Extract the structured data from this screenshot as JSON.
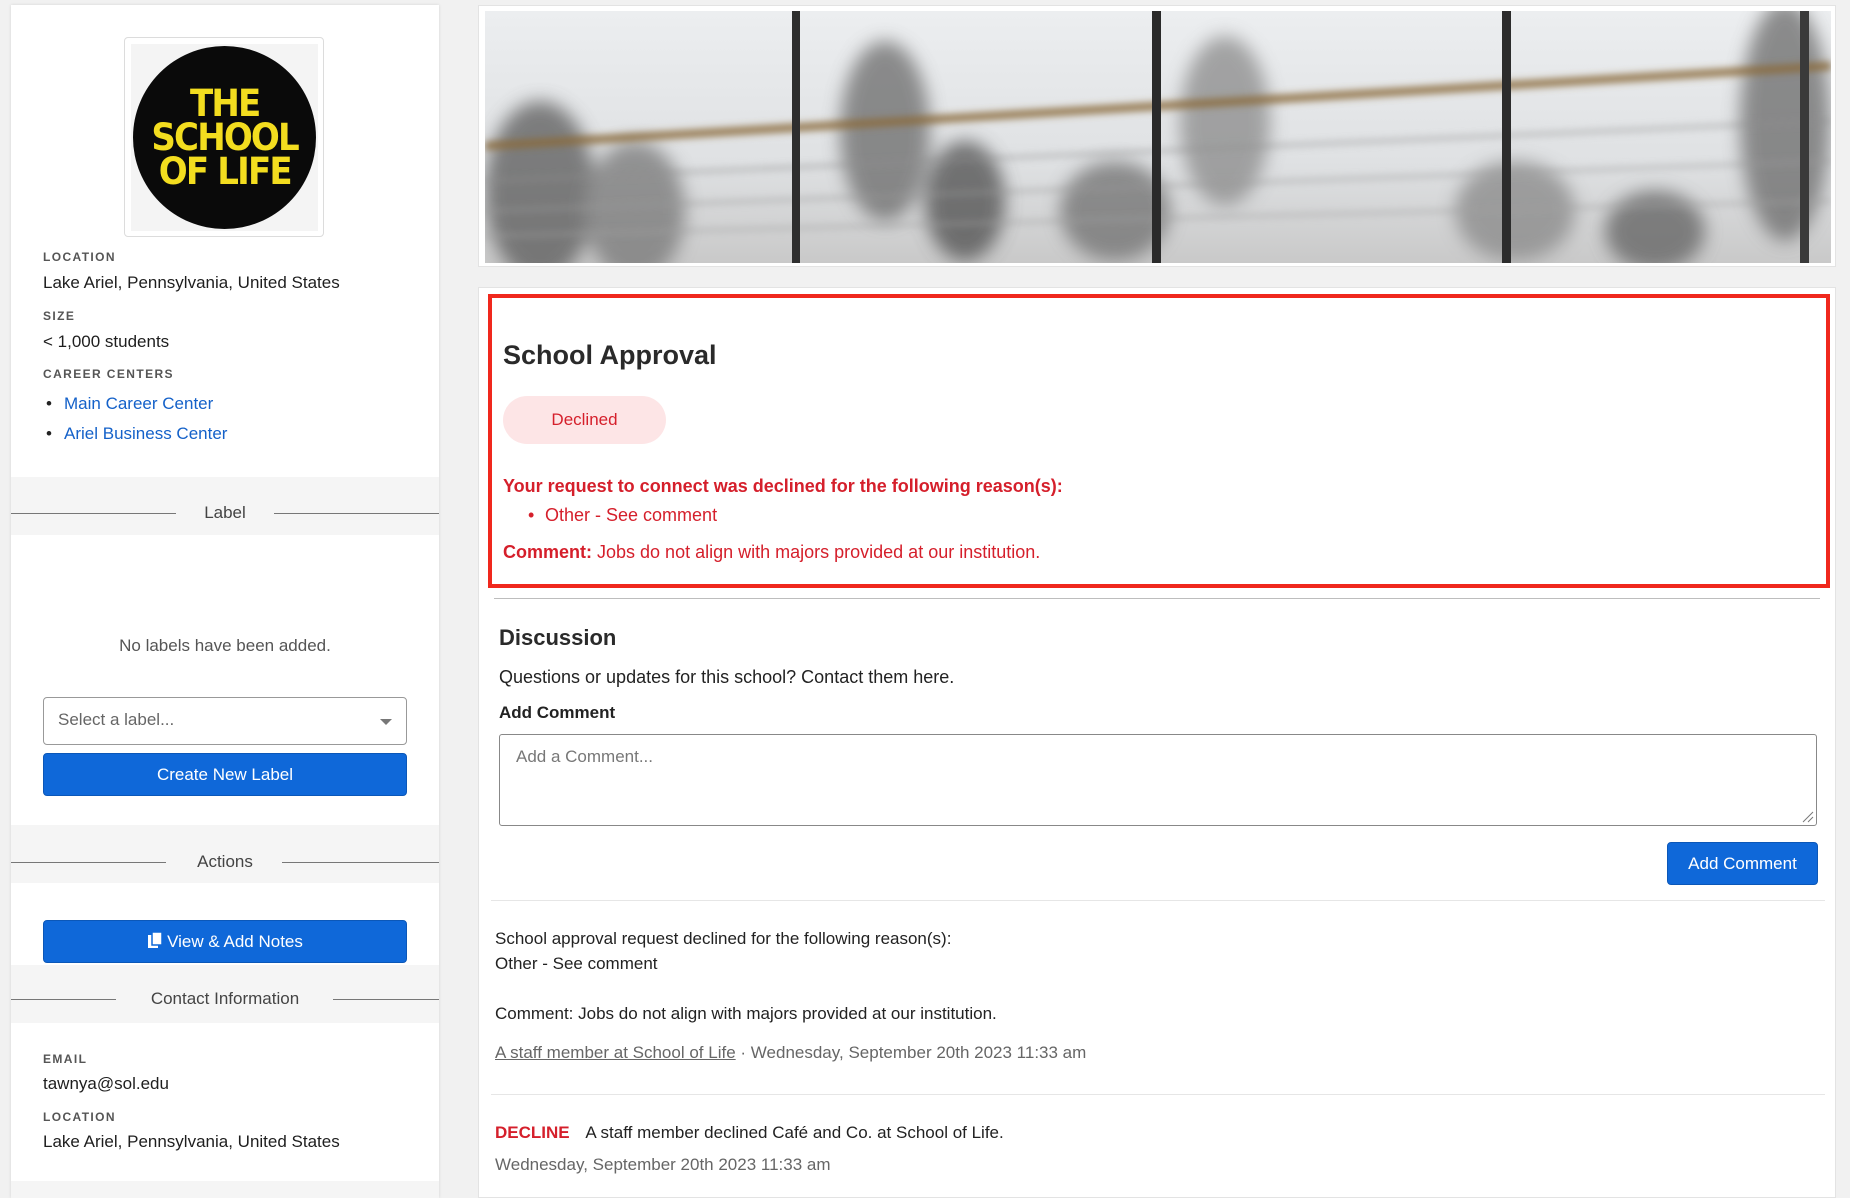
{
  "school": {
    "logo_text": [
      "THE",
      "SCHOOL",
      "OF LIFE"
    ],
    "location_label": "LOCATION",
    "location": "Lake Ariel, Pennsylvania, United States",
    "size_label": "SIZE",
    "size": "< 1,000 students",
    "career_centers_label": "CAREER CENTERS",
    "career_centers": [
      "Main Career Center",
      "Ariel Business Center"
    ]
  },
  "labels_section": {
    "title": "Label",
    "empty_text": "No labels have been added.",
    "select_placeholder": "Select a label...",
    "create_button": "Create New Label"
  },
  "actions_section": {
    "title": "Actions",
    "notes_button": "View & Add Notes"
  },
  "contact_section": {
    "title": "Contact Information",
    "email_label": "EMAIL",
    "email": "tawnya@sol.edu",
    "location_label": "LOCATION",
    "location": "Lake Ariel, Pennsylvania, United States"
  },
  "approval": {
    "title": "School Approval",
    "status": "Declined",
    "reason_heading": "Your request to connect was declined for the following reason(s):",
    "reasons": [
      "Other - See comment"
    ],
    "comment_label": "Comment:",
    "comment": "Jobs do not align with majors provided at our institution."
  },
  "discussion": {
    "title": "Discussion",
    "subtitle": "Questions or updates for this school? Contact them here.",
    "add_comment_label": "Add Comment",
    "comment_placeholder": "Add a Comment...",
    "add_comment_button": "Add Comment"
  },
  "feed": [
    {
      "line1": "School approval request declined for the following reason(s):",
      "line2": "Other - See comment",
      "line3": "Comment: Jobs do not align with majors provided at our institution.",
      "author": "A staff member at School of Life",
      "separator": "·",
      "timestamp": "Wednesday, September 20th 2023 11:33 am"
    },
    {
      "tag": "DECLINE",
      "text": "A staff member declined Café and Co. at School of Life.",
      "timestamp": "Wednesday, September 20th 2023 11:33 am"
    }
  ],
  "colors": {
    "primary_blue": "#0f68d9",
    "link_blue": "#1461c9",
    "decline_red": "#d51f2b",
    "highlight_red": "#f0281d",
    "badge_bg": "#fde5e6",
    "logo_yellow": "#f3dd1f"
  }
}
